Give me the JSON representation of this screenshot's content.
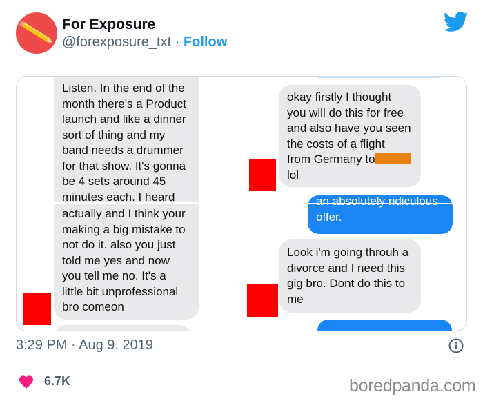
{
  "author": {
    "name": "For Exposure",
    "handle": "@forexposure_txt",
    "separator": " · ",
    "follow_label": "Follow"
  },
  "icons": {
    "brand": "twitter-bird-icon",
    "info": "info-icon",
    "like": "heart-icon",
    "avatar_art": "pencil-icon"
  },
  "colors": {
    "brand_blue": "#1d9bf0",
    "heart": "#f91880",
    "avatar_bg": "#ee4a4a",
    "censor_red": "#ff0000",
    "censor_orange": "#e8820c",
    "imessage_blue": "#1a86f5",
    "imessage_gray": "#e9e9eb"
  },
  "conversation": {
    "left_bubble_1_lines": [
      "Listen. In the end of the",
      "month there's a Product",
      "launch and like a dinner",
      "sort of thing and my",
      "band needs a drummer",
      "for that show. It's gonna",
      "be 4 sets around 45",
      "minutes each. I heard"
    ],
    "left_bubble_2_lines": [
      "actually and I think your",
      "making a big mistake to",
      "not do it. also you just",
      "told me yes and now",
      "you tell me no. It's a",
      "little bit unprofessional",
      "bro comeon"
    ],
    "right_gray_1_lines": [
      "okay firstly I thought",
      "you will do this for free",
      "and also have you seen",
      "the costs of a flight",
      "from Germany to",
      "lol"
    ],
    "right_blue_1_lines": [
      "an absolutely ridiculous",
      "offer."
    ],
    "right_gray_2_lines": [
      "Look i'm going throuh a",
      "divorce and I need this",
      "gig bro. Dont do this to",
      "me"
    ]
  },
  "footer": {
    "timestamp": "3:29 PM · Aug 9, 2019",
    "likes": "6.7K",
    "watermark": "boredpanda.com"
  }
}
